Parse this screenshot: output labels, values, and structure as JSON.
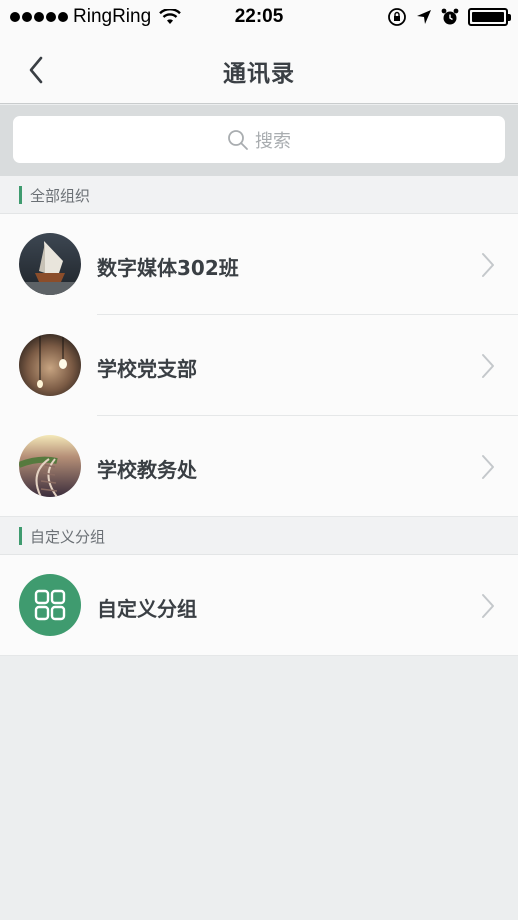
{
  "status_bar": {
    "carrier": "RingRing",
    "time": "22:05"
  },
  "nav": {
    "title": "通讯录"
  },
  "search": {
    "placeholder": "搜索"
  },
  "sections": [
    {
      "title": "全部组织",
      "items": [
        {
          "label": "数字媒体302班",
          "icon": "boat-photo-avatar"
        },
        {
          "label": "学校党支部",
          "icon": "lightbulb-photo-avatar"
        },
        {
          "label": "学校教务处",
          "icon": "railway-photo-avatar"
        }
      ]
    },
    {
      "title": "自定义分组",
      "items": [
        {
          "label": "自定义分组",
          "icon": "grid-icon"
        }
      ]
    }
  ],
  "colors": {
    "accent": "#3f9b6f",
    "background": "#eceeef",
    "list_background": "#fbfbfb"
  }
}
